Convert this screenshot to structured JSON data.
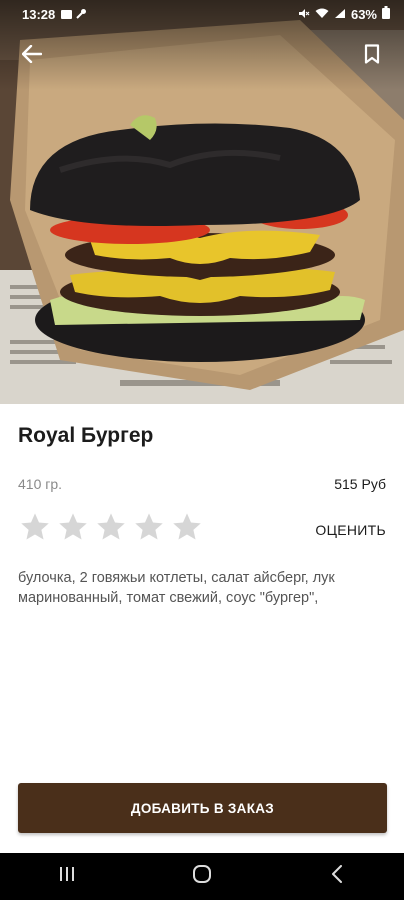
{
  "status_bar": {
    "time": "13:28",
    "battery": "63%",
    "icons": [
      "image-icon",
      "wrench-icon",
      "mute-icon",
      "wifi-icon",
      "signal-icon",
      "battery-icon"
    ]
  },
  "top_bar": {
    "back_icon": "arrow-left-icon",
    "bookmark_icon": "bookmark-icon"
  },
  "product": {
    "title": "Royal Бургер",
    "weight": "410 гр.",
    "price": "515 Руб",
    "rating": {
      "filled": 0,
      "max": 5
    },
    "rate_label": "ОЦЕНИТЬ",
    "description": "булочка, 2 говяжьи котлеты, салат айсберг, лук маринованный, томат свежий, соус \"бургер\","
  },
  "actions": {
    "add_label": "ДОБАВИТЬ В ЗАКАЗ"
  },
  "nav_bar": {
    "items": [
      "recents-icon",
      "home-icon",
      "back-icon"
    ]
  },
  "colors": {
    "primary_button": "#4a2f1a",
    "star_empty": "#d6d6d6",
    "text_dark": "#1c1c1c",
    "text_muted": "#8a8a8a"
  }
}
